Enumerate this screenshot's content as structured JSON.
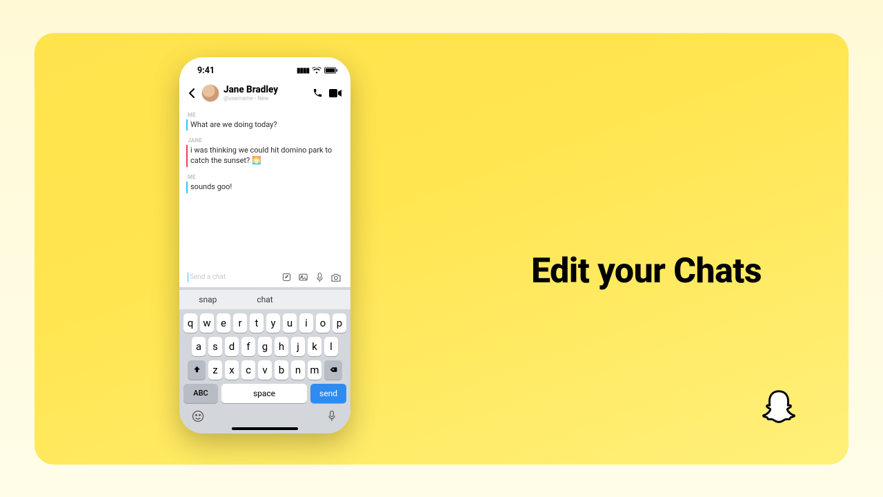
{
  "headline": "Edit your Chats",
  "status": {
    "time": "9:41"
  },
  "header": {
    "contact_name": "Jane Bradley",
    "contact_sub": "@username • New"
  },
  "messages": [
    {
      "sender": "ME",
      "text": "What are we doing today?",
      "color": "blue"
    },
    {
      "sender": "JANE",
      "text": "i was thinking we could hit domino park to catch the sunset? 🌅",
      "color": "red"
    },
    {
      "sender": "ME",
      "text": "sounds goo!",
      "color": "blue"
    }
  ],
  "input": {
    "placeholder": "Send a chat"
  },
  "keyboard": {
    "suggestions": [
      "snap",
      "chat",
      ""
    ],
    "row1": [
      "q",
      "w",
      "e",
      "r",
      "t",
      "y",
      "u",
      "i",
      "o",
      "p"
    ],
    "row2": [
      "a",
      "s",
      "d",
      "f",
      "g",
      "h",
      "j",
      "k",
      "l"
    ],
    "row3": [
      "z",
      "x",
      "c",
      "v",
      "b",
      "n",
      "m"
    ],
    "abc": "ABC",
    "space": "space",
    "send": "send"
  }
}
